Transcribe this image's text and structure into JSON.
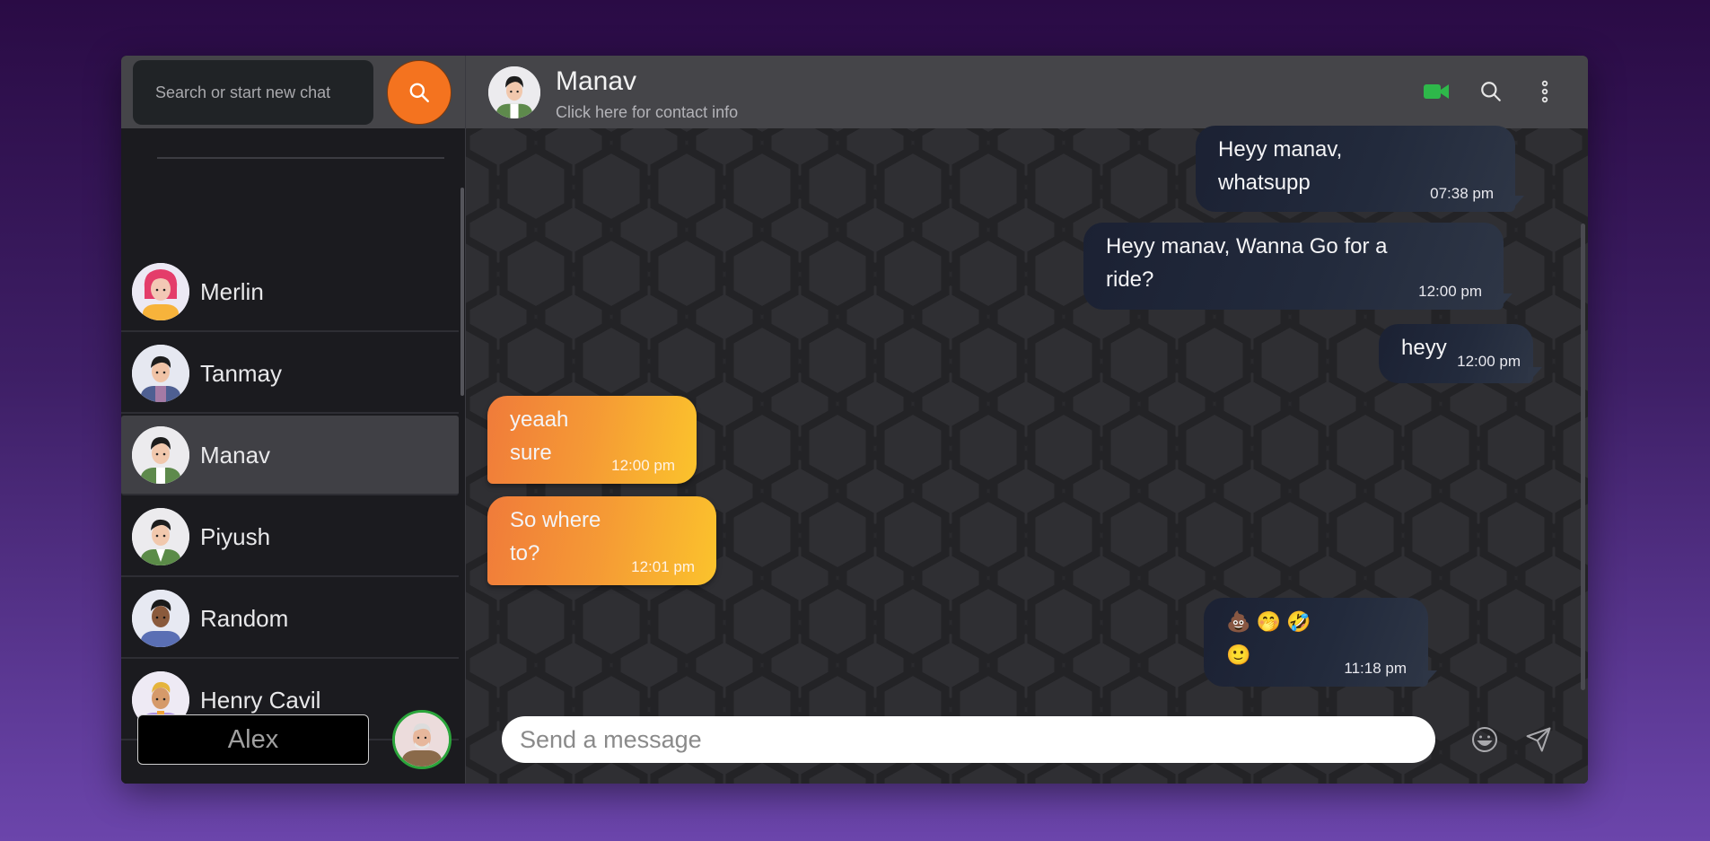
{
  "sidebar": {
    "search_placeholder": "Search or start new chat",
    "contacts": [
      {
        "name": "Merlin"
      },
      {
        "name": "Tanmay"
      },
      {
        "name": "Manav",
        "active": true
      },
      {
        "name": "Piyush"
      },
      {
        "name": "Random"
      },
      {
        "name": "Henry Cavil"
      }
    ],
    "current_user": "Alex"
  },
  "chat": {
    "contact_name": "Manav",
    "contact_subtitle": "Click here for contact info",
    "messages": [
      {
        "direction": "outgoing",
        "text": "Heyy manav, whatsupp",
        "time": "07:38 pm"
      },
      {
        "direction": "outgoing",
        "text": "Heyy manav, Wanna Go for a ride?",
        "time": "12:00 pm"
      },
      {
        "direction": "outgoing",
        "text": "heyy",
        "time": "12:00 pm"
      },
      {
        "direction": "incoming",
        "text": "yeaah sure",
        "time": "12:00 pm"
      },
      {
        "direction": "incoming",
        "text": "So where to?",
        "time": "12:01 pm"
      },
      {
        "direction": "outgoing",
        "text": "💩 🤭 🤣 🙂",
        "time": "11:18 pm"
      }
    ],
    "composer_placeholder": "Send a message"
  },
  "icons": [
    "search-icon",
    "video-call-icon",
    "chat-search-icon",
    "more-options-icon",
    "emoji-icon",
    "send-icon"
  ],
  "colors": {
    "accent": "#f4731f",
    "incoming_bubble_start": "#f07b3a",
    "incoming_bubble_end": "#fbc32c",
    "outgoing_bubble": "#1f2638",
    "video_icon": "#2eb84a",
    "online_ring": "#2ba53b"
  }
}
